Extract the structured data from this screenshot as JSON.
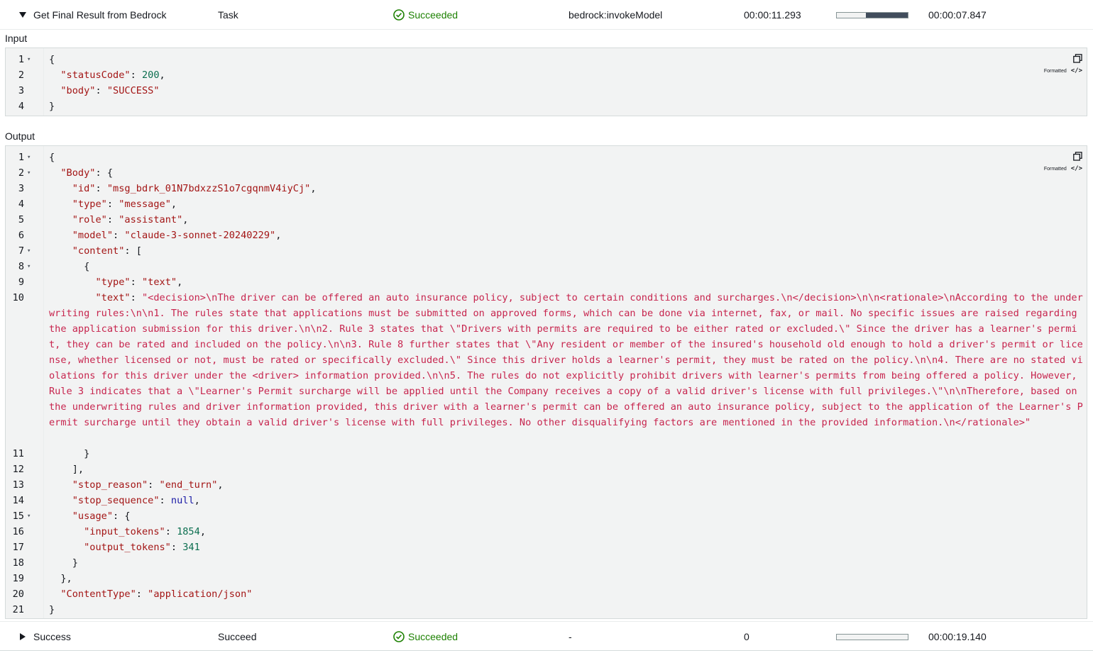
{
  "top_row": {
    "name": "Get Final Result from Bedrock",
    "type": "Task",
    "status": "Succeeded",
    "resource": "bedrock:invokeModel",
    "started_after": "00:00:11.293",
    "duration": "00:00:07.847",
    "timeline": {
      "start_fraction": 0.41,
      "end_fraction": 1.0
    }
  },
  "input": {
    "label": "Input",
    "format_label": "Formatted",
    "lines": [
      {
        "n": "1",
        "fold": true
      },
      {
        "n": "2",
        "fold": false
      },
      {
        "n": "3",
        "fold": false
      },
      {
        "n": "4",
        "fold": false
      }
    ]
  },
  "output": {
    "label": "Output",
    "format_label": "Formatted",
    "text_value": "\"<decision>\\nThe driver can be offered an auto insurance policy, subject to certain conditions and surcharges.\\n</decision>\\n\\n<rationale>\\nAccording to the underwriting rules:\\n\\n1. The rules state that applications must be submitted on approved forms, which can be done via internet, fax, or mail. No specific issues are raised regarding the application submission for this driver.\\n\\n2. Rule 3 states that \\\"Drivers with permits are required to be either rated or excluded.\\\" Since the driver has a learner's permit, they can be rated and included on the policy.\\n\\n3. Rule 8 further states that \\\"Any resident or member of the insured's household old enough to hold a driver's permit or license, whether licensed or not, must be rated or specifically excluded.\\\" Since this driver holds a learner's permit, they must be rated on the policy.\\n\\n4. There are no stated violations for this driver under the <driver> information provided.\\n\\n5. The rules do not explicitly prohibit drivers with learner's permits from being offered a policy. However, Rule 3 indicates that a \\\"Learner's Permit surcharge will be applied until the Company receives a copy of a valid driver's license with full privileges.\\\"\\n\\nTherefore, based on the underwriting rules and driver information provided, this driver with a learner's permit can be offered an auto insurance policy, subject to the application of the Learner's Permit surcharge until they obtain a valid driver's license with full privileges. No other disqualifying factors are mentioned in the provided information.\\n</rationale>\"",
    "values": {
      "status_code": "200",
      "body": "\"SUCCESS\"",
      "id": "\"msg_bdrk_01N7bdxzzS1o7cgqnmV4iyCj\"",
      "type": "\"message\"",
      "role": "\"assistant\"",
      "model": "\"claude-3-sonnet-20240229\"",
      "content_type": "\"text\"",
      "stop_reason": "\"end_turn\"",
      "stop_sequence": "null",
      "input_tokens": "1854",
      "output_tokens": "341",
      "content_type_header": "\"application/json\""
    }
  },
  "bottom_row": {
    "name": "Success",
    "type": "Succeed",
    "status": "Succeeded",
    "resource": "-",
    "started_after": "0",
    "duration": "00:00:19.140",
    "timeline": {
      "start_fraction": 1.0,
      "end_fraction": 1.0
    }
  }
}
